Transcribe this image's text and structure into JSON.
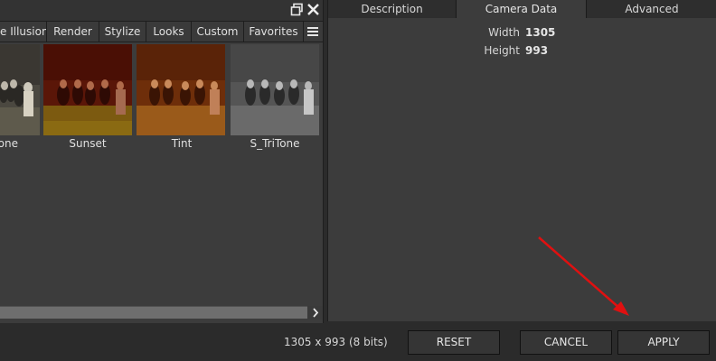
{
  "left_panel": {
    "category_tabs": [
      {
        "label": "e Illusion"
      },
      {
        "label": "Render"
      },
      {
        "label": "Stylize"
      },
      {
        "label": "Looks"
      },
      {
        "label": "Custom"
      },
      {
        "label": "Favorites"
      }
    ],
    "thumbnails": [
      {
        "label": "one"
      },
      {
        "label": "Sunset"
      },
      {
        "label": "Tint"
      },
      {
        "label": "S_TriTone"
      }
    ]
  },
  "right_panel": {
    "tabs": [
      {
        "label": "Description"
      },
      {
        "label": "Camera Data"
      },
      {
        "label": "Advanced"
      }
    ],
    "camera_data": {
      "width_label": "Width",
      "width_value": "1305",
      "height_label": "Height",
      "height_value": "993"
    }
  },
  "footer": {
    "status": "1305 x 993 (8 bits)",
    "reset_label": "RESET",
    "cancel_label": "CANCEL",
    "apply_label": "APPLY"
  },
  "colors": {
    "annotation_arrow": "#e01010",
    "panel_bg": "#3c3c3c"
  }
}
